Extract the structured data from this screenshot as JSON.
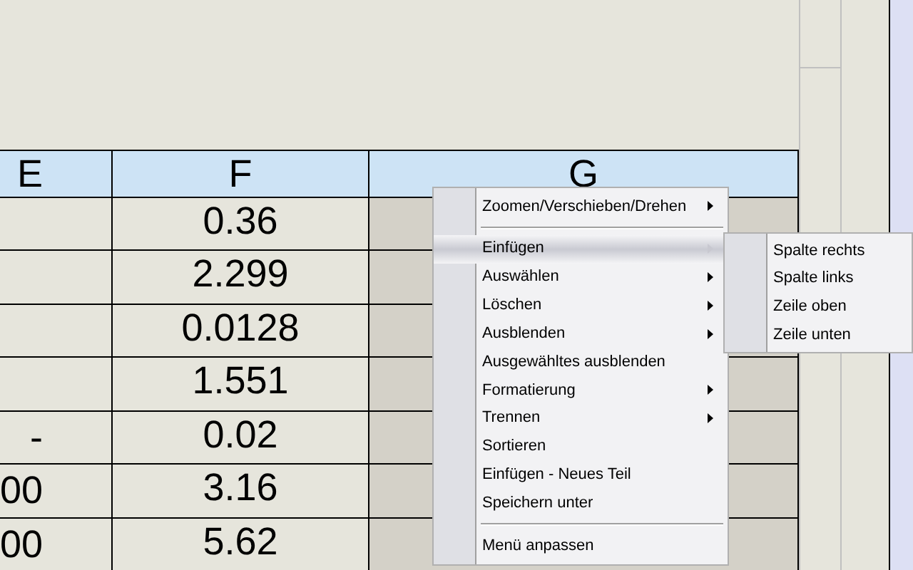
{
  "table": {
    "columns": [
      "E",
      "F",
      "G"
    ],
    "rows": [
      {
        "e": "",
        "f": "0.36",
        "selected": true
      },
      {
        "e": "",
        "f": "2.299",
        "selected": true
      },
      {
        "e": "",
        "f": "0.0128",
        "selected": true
      },
      {
        "e": "",
        "f": "1.551",
        "selected": true
      },
      {
        "e": "-",
        "f": "0.02",
        "selected": true
      },
      {
        "e": "00",
        "f": "3.16",
        "selected": true
      },
      {
        "e": "00",
        "f": "5.62",
        "selected": true
      }
    ]
  },
  "context_menu": {
    "items": [
      {
        "kind": "item",
        "label": "Zoomen/Verschieben/Drehen",
        "submenu": true,
        "selected": false
      },
      {
        "kind": "separator"
      },
      {
        "kind": "item",
        "label": "Einfügen",
        "submenu": true,
        "selected": true
      },
      {
        "kind": "item",
        "label": "Auswählen",
        "submenu": true,
        "selected": false
      },
      {
        "kind": "item",
        "label": "Löschen",
        "submenu": true,
        "selected": false
      },
      {
        "kind": "item",
        "label": "Ausblenden",
        "submenu": true,
        "selected": false
      },
      {
        "kind": "item",
        "label": "Ausgewähltes ausblenden",
        "submenu": false,
        "selected": false
      },
      {
        "kind": "item",
        "label": "Formatierung",
        "submenu": true,
        "selected": false
      },
      {
        "kind": "item",
        "label": "Trennen",
        "submenu": true,
        "selected": false
      },
      {
        "kind": "item",
        "label": "Sortieren",
        "submenu": false,
        "selected": false
      },
      {
        "kind": "item",
        "label": "Einfügen - Neues Teil",
        "submenu": false,
        "selected": false
      },
      {
        "kind": "item",
        "label": "Speichern unter",
        "submenu": false,
        "selected": false
      },
      {
        "kind": "separator"
      },
      {
        "kind": "item",
        "label": "Menü anpassen",
        "submenu": false,
        "selected": false
      }
    ]
  },
  "submenu": {
    "items": [
      "Spalte rechts",
      "Spalte links",
      "Zeile oben",
      "Zeile unten"
    ]
  }
}
